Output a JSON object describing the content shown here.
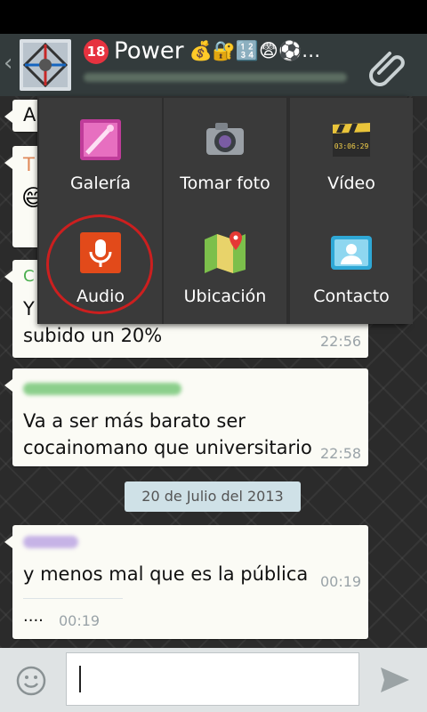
{
  "header": {
    "back_icon": "back-chevron-icon",
    "title_badge": "18",
    "title": "Power",
    "title_emoji": "💰🔐🔢😨⚽…",
    "attach_icon": "paperclip-icon"
  },
  "attach_menu": {
    "items": [
      {
        "label": "Galería",
        "icon": "gallery-icon"
      },
      {
        "label": "Tomar foto",
        "icon": "camera-icon"
      },
      {
        "label": "Vídeo",
        "icon": "video-icon"
      },
      {
        "label": "Audio",
        "icon": "microphone-icon"
      },
      {
        "label": "Ubicación",
        "icon": "map-location-icon"
      },
      {
        "label": "Contacto",
        "icon": "contact-card-icon"
      }
    ],
    "video_time": "03:06:29"
  },
  "messages": [
    {
      "text": "A"
    },
    {
      "text": "T"
    },
    {
      "line1": "Y",
      "line2": "subido un 20%",
      "time": "22:56"
    },
    {
      "line1": "Va a ser más barato ser",
      "line2": "cocainomano que universitario",
      "time": "22:58"
    },
    {
      "text": "y menos mal que es la pública",
      "time": "00:19"
    },
    {
      "text": "....",
      "time": "00:19"
    }
  ],
  "date_separator": "20 de Julio del 2013",
  "footer": {
    "smiley_icon": "smiley-icon",
    "send_icon": "send-icon",
    "input_value": ""
  },
  "colors": {
    "header_bg": "#333b3c",
    "bubble_bg": "#fbfbf5",
    "highlight": "#cc1f1f",
    "date_pill": "#cfe1e7"
  }
}
